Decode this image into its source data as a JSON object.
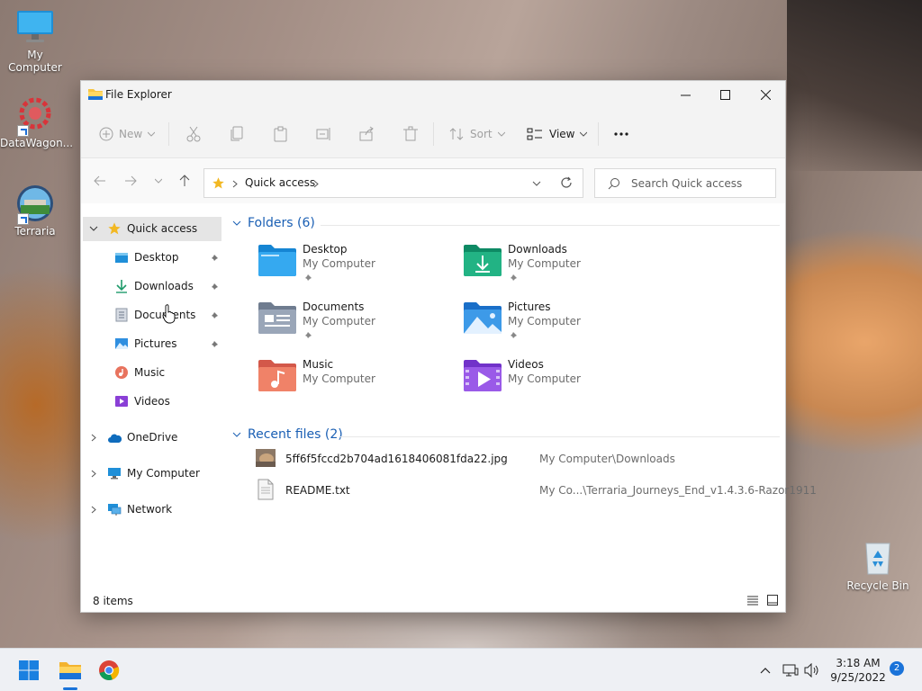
{
  "desktop": {
    "icons": [
      {
        "label": "My Computer"
      },
      {
        "label": "DataWagon..."
      },
      {
        "label": "Terraria"
      },
      {
        "label": "Recycle Bin"
      }
    ]
  },
  "window": {
    "title": "File Explorer",
    "toolbar": {
      "new_label": "New",
      "sort_label": "Sort",
      "view_label": "View"
    },
    "address": {
      "location": "Quick access"
    },
    "search": {
      "placeholder": "Search Quick access"
    },
    "sidebar": {
      "items": [
        {
          "label": "Quick access"
        },
        {
          "label": "Desktop"
        },
        {
          "label": "Downloads"
        },
        {
          "label": "Documents"
        },
        {
          "label": "Pictures"
        },
        {
          "label": "Music"
        },
        {
          "label": "Videos"
        },
        {
          "label": "OneDrive"
        },
        {
          "label": "My Computer"
        },
        {
          "label": "Network"
        }
      ]
    },
    "folders_heading": "Folders (6)",
    "folders": [
      {
        "name": "Desktop",
        "location": "My Computer"
      },
      {
        "name": "Downloads",
        "location": "My Computer"
      },
      {
        "name": "Documents",
        "location": "My Computer"
      },
      {
        "name": "Pictures",
        "location": "My Computer"
      },
      {
        "name": "Music",
        "location": "My Computer"
      },
      {
        "name": "Videos",
        "location": "My Computer"
      }
    ],
    "recent_heading": "Recent files (2)",
    "recent_files": [
      {
        "name": "5ff6f5fccd2b704ad1618406081fda22.jpg",
        "path": "My Computer\\Downloads"
      },
      {
        "name": "README.txt",
        "path": "My Co...\\Terraria_Journeys_End_v1.4.3.6-Razor1911"
      }
    ],
    "status": {
      "item_count": "8 items"
    }
  },
  "taskbar": {
    "time": "3:18 AM",
    "date": "9/25/2022",
    "notification_count": "2"
  },
  "colors": {
    "accent": "#1a73d9",
    "section_heading": "#1a5fb4",
    "selected_bg": "#e5e5e5"
  }
}
